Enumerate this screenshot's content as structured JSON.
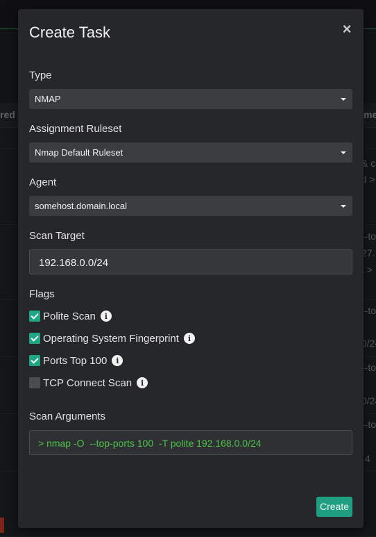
{
  "modal": {
    "title": "Create Task",
    "close_glyph": "×",
    "type": {
      "label": "Type",
      "value": "NMAP"
    },
    "ruleset": {
      "label": "Assignment Ruleset",
      "value": "Nmap Default Ruleset"
    },
    "agent": {
      "label": "Agent",
      "value": "somehost.domain.local"
    },
    "scan_target": {
      "label": "Scan Target",
      "value": "192.168.0.0/24"
    },
    "flags": {
      "label": "Flags",
      "items": [
        {
          "label": "Polite Scan",
          "checked": true
        },
        {
          "label": "Operating System Fingerprint",
          "checked": true
        },
        {
          "label": "Ports Top 100",
          "checked": true
        },
        {
          "label": "TCP Connect Scan",
          "checked": false
        }
      ]
    },
    "scan_arguments": {
      "label": "Scan Arguments",
      "value": "> nmap -O  --top-ports 100  -T polite 192.168.0.0/24"
    },
    "create_label": "Create",
    "info_glyph": "i"
  },
  "background": {
    "left_header": "red i",
    "right_header": "me",
    "right_fragments": [
      "& c",
      "d >",
      "--to",
      "27.",
      "t >",
      "--to",
      "0/24",
      "--to",
      "0/24",
      "--to",
      "4"
    ]
  },
  "colors": {
    "accent": "#1f9e82",
    "args_text": "#4cc34a",
    "modal_bg": "#26272a"
  }
}
